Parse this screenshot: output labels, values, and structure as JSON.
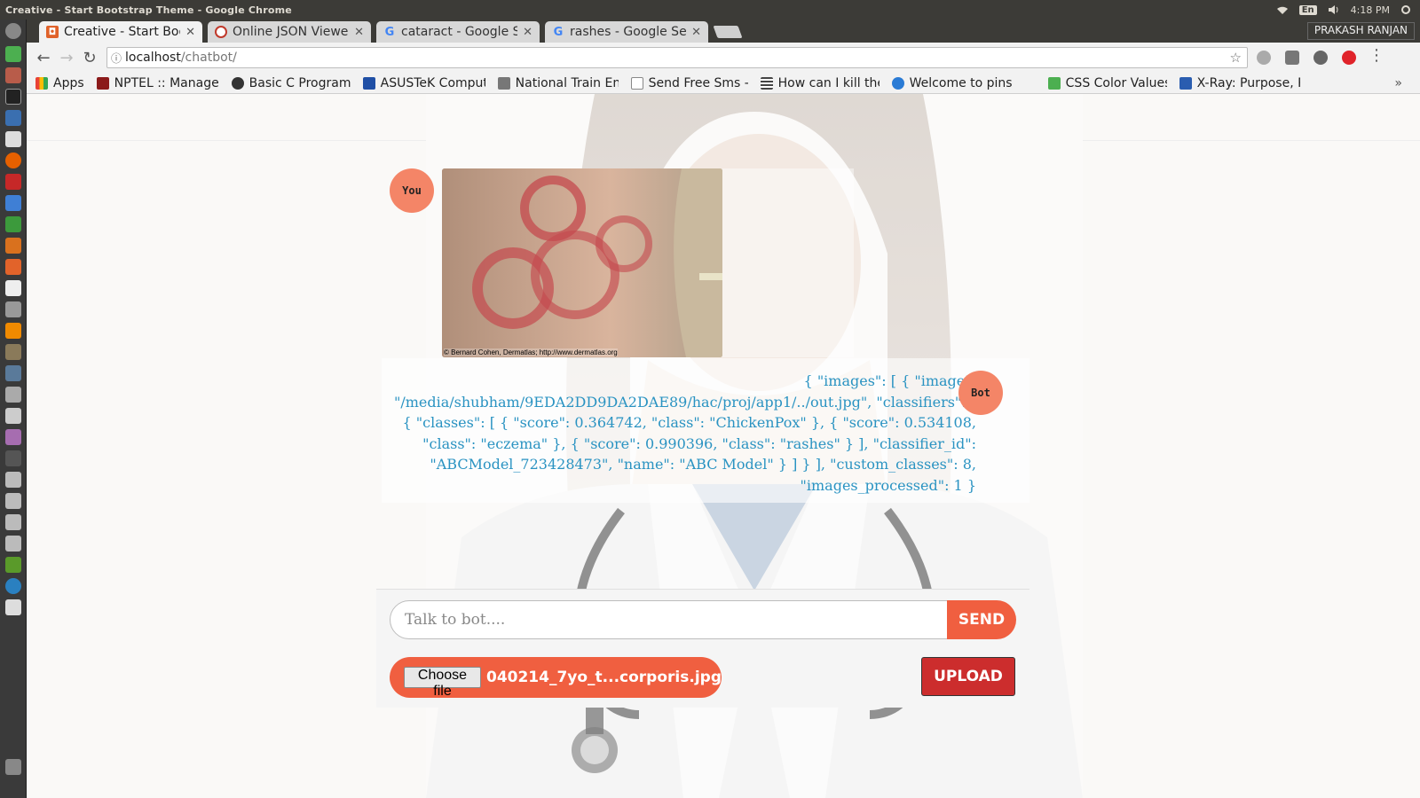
{
  "os": {
    "window_title": "Creative - Start Bootstrap Theme - Google Chrome",
    "lang": "En",
    "time": "4:18 PM",
    "user": "PRAKASH RANJAN"
  },
  "tabs": [
    {
      "label": "Creative - Start Boo",
      "fav_color": "#e0622a",
      "active": true
    },
    {
      "label": "Online JSON Viewe",
      "fav_color": "#c0392b",
      "active": false
    },
    {
      "label": "cataract - Google Se",
      "fav_color": "#4285f4",
      "active": false
    },
    {
      "label": "rashes - Google Sea",
      "fav_color": "#4285f4",
      "active": false
    }
  ],
  "address": {
    "host": "localhost",
    "path": "/chatbot/"
  },
  "bookmarks": [
    {
      "label": "Apps",
      "color": "#e94235"
    },
    {
      "label": "NPTEL :: Manage",
      "color": "#8b1a1a"
    },
    {
      "label": "Basic C Programs",
      "color": "#333333"
    },
    {
      "label": "ASUSTeK Comput",
      "color": "#1f4fa5"
    },
    {
      "label": "National Train En",
      "color": "#555555"
    },
    {
      "label": "Send Free Sms - S",
      "color": "#dddddd"
    },
    {
      "label": "How can I kill the",
      "color": "#444444"
    },
    {
      "label": "Welcome to pins",
      "color": "#2a7bd5"
    },
    {
      "label": "CSS Color Values",
      "color": "#4caf50"
    },
    {
      "label": "X-Ray: Purpose, P",
      "color": "#2a5db0"
    }
  ],
  "chat": {
    "user_avatar": "You",
    "bot_avatar": "Bot",
    "image_credit": "© Bernard Cohen, Dermatlas; http://www.dermatlas.org",
    "bot_message": "{ \"images\": [ { \"image\": \"/media/shubham/9EDA2DD9DA2DAE89/hac/proj/app1/../out.jpg\", \"classifiers\": [ { \"classes\": [ { \"score\": 0.364742, \"class\": \"ChickenPox\" }, { \"score\": 0.534108, \"class\": \"eczema\" }, { \"score\": 0.990396, \"class\": \"rashes\" } ], \"classifier_id\": \"ABCModel_723428473\", \"name\": \"ABC Model\" } ] } ], \"custom_classes\": 8, \"images_processed\": 1 }"
  },
  "input": {
    "placeholder": "Talk to bot....",
    "send_label": "SEND",
    "choose_label": "Choose file",
    "file_name": "040214_7yo_t...corporis.jpg",
    "upload_label": "UPLOAD"
  },
  "colors": {
    "accent": "#f05f40",
    "upload": "#cc2d2d",
    "bot_text": "#2a93c2"
  }
}
